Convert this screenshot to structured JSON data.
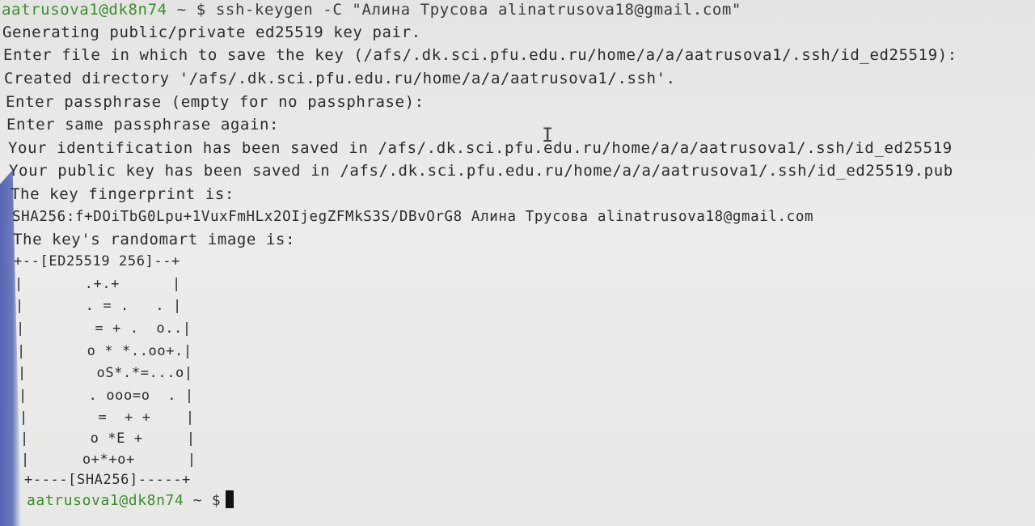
{
  "terminal": {
    "first_prompt_user": "aatrusova1@dk8n74",
    "first_prompt_rest": " ~ $ ssh-keygen -C \"Алина Трусова alinatrusova18@gmail.com\"",
    "output_lines": [
      "Generating public/private ed25519 key pair.",
      "Enter file in which to save the key (/afs/.dk.sci.pfu.edu.ru/home/a/a/aatrusova1/.ssh/id_ed25519):",
      "Created directory '/afs/.dk.sci.pfu.edu.ru/home/a/a/aatrusova1/.ssh'.",
      "Enter passphrase (empty for no passphrase):",
      "Enter same passphrase again:",
      "Your identification has been saved in /afs/.dk.sci.pfu.edu.ru/home/a/a/aatrusova1/.ssh/id_ed25519",
      "Your public key has been saved in /afs/.dk.sci.pfu.edu.ru/home/a/a/aatrusova1/.ssh/id_ed25519.pub",
      "The key fingerprint is:",
      "SHA256:f+DOiTbG0Lpu+1VuxFmHLx2OIjegZFMkS3S/DBvOrG8 Алина Трусова alinatrusova18@gmail.com",
      "The key's randomart image is:",
      "+--[ED25519 256]--+",
      "|       .+.+      |",
      "|       . = .   . |",
      "|        = + .  o..|",
      "|       o * *..oo+.|",
      "|        oS*.*=...o|",
      "|       . ooo=o  . |",
      "|        =  + +    |",
      "|       o *E +     |",
      "|      o+*+o+      |",
      "+----[SHA256]-----+"
    ],
    "last_prompt_user": "aatrusova1@dk8n74",
    "last_prompt_rest": " ~ $"
  }
}
